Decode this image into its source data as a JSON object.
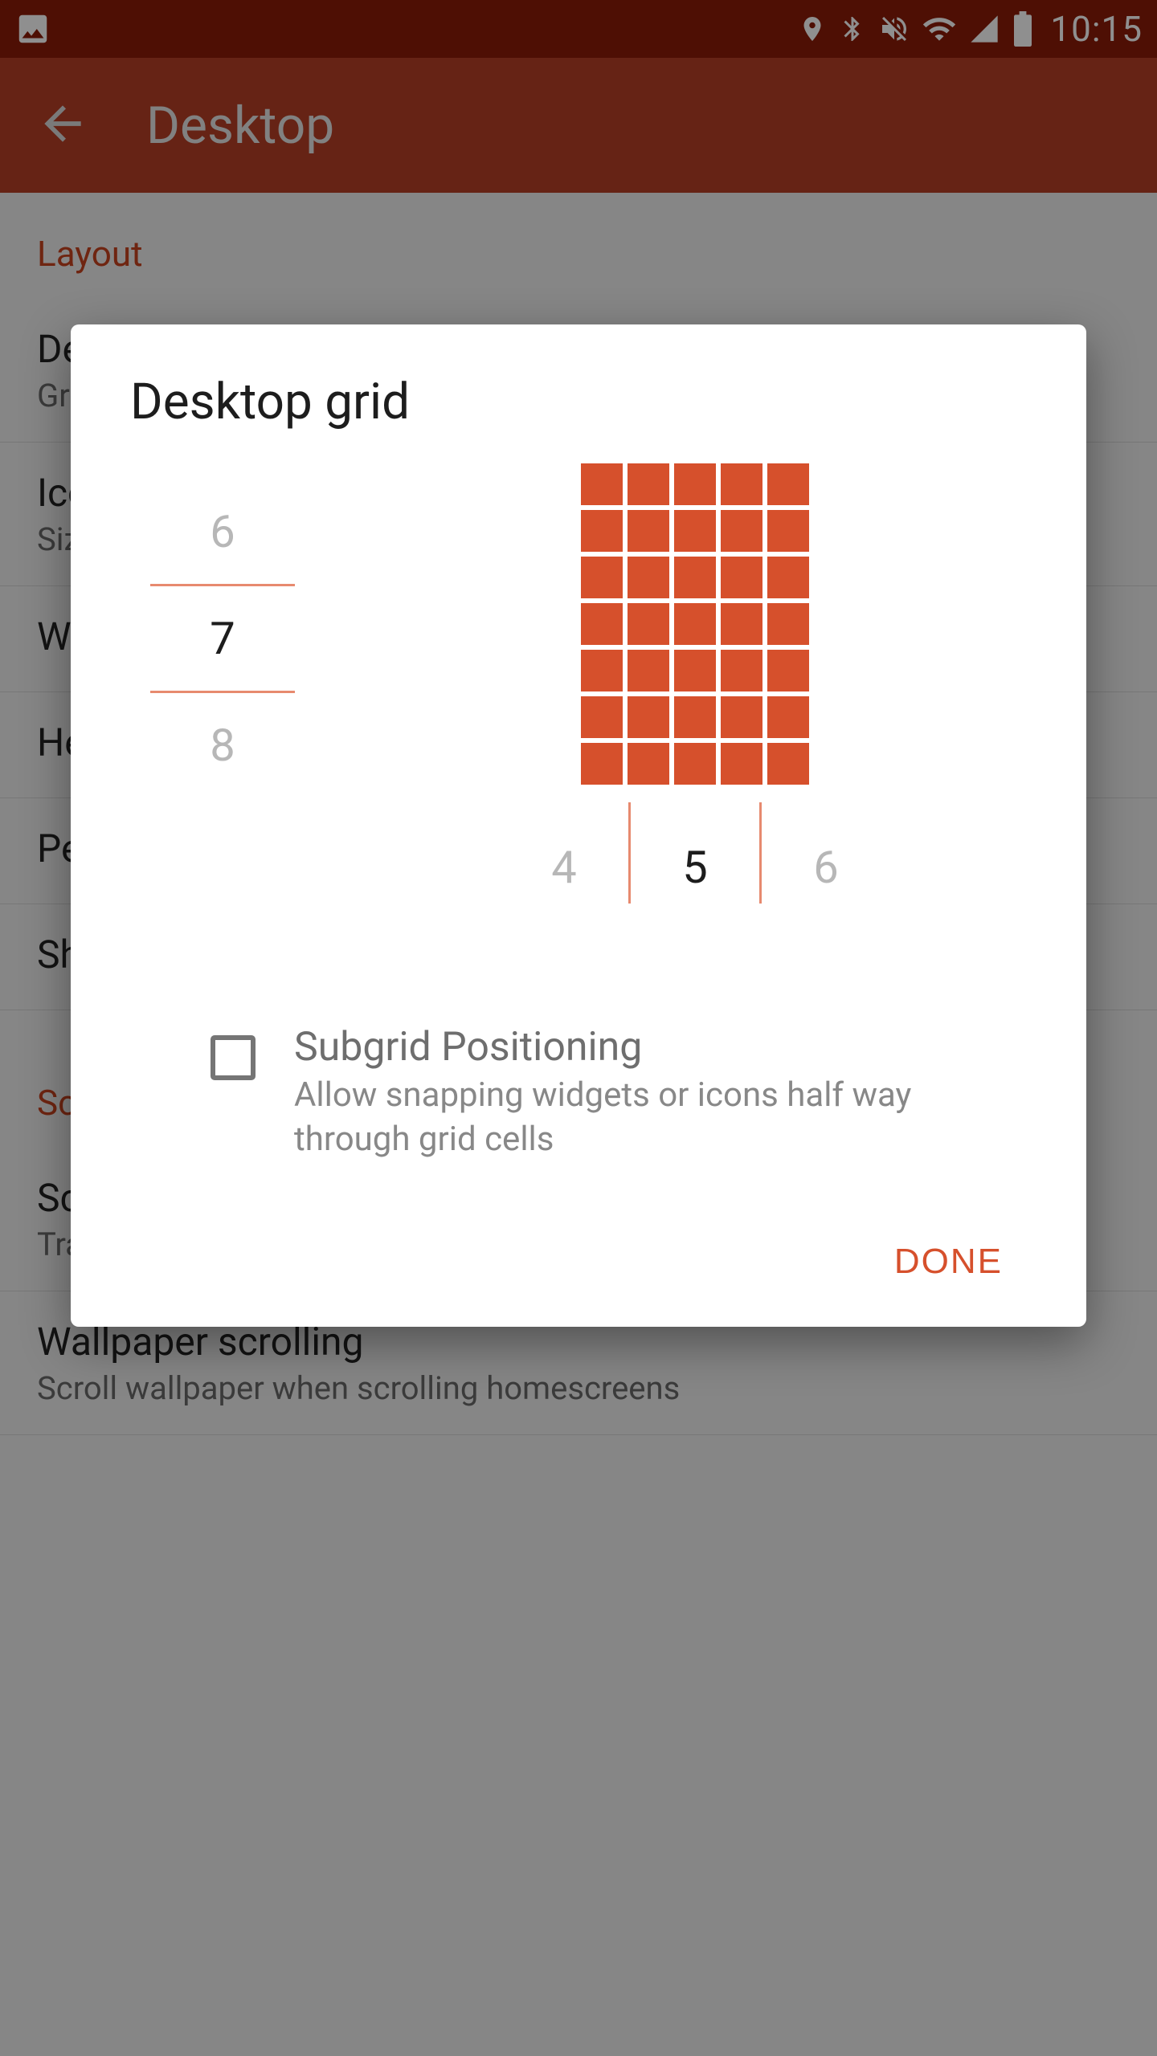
{
  "status": {
    "clock": "10:15"
  },
  "appbar": {
    "title": "Desktop"
  },
  "sections": {
    "layout_header": "Layout",
    "scrolling_header": "Scrolling"
  },
  "prefs": {
    "desktop_grid": {
      "title": "Desktop grid",
      "sub": "Grid size used on the main home screen"
    },
    "icon_size": {
      "title": "Icon layout",
      "sub": "Size and labels of desktop icons"
    },
    "width": {
      "title": "Width padding"
    },
    "height": {
      "title": "Height padding"
    },
    "persistent": {
      "title": "Persistent search bar"
    },
    "shadow": {
      "title": "Shadow effect"
    },
    "scroll_effect": {
      "title": "Scroll effect",
      "sub": "Transition effect when scrolling between home screens"
    },
    "wallpaper": {
      "title": "Wallpaper scrolling",
      "sub": "Scroll wallpaper when scrolling homescreens"
    }
  },
  "dialog": {
    "title": "Desktop grid",
    "rows": {
      "prev": "6",
      "current": "7",
      "next": "8",
      "value": 7
    },
    "cols": {
      "prev": "4",
      "current": "5",
      "next": "6",
      "value": 5
    },
    "subgrid": {
      "title": "Subgrid Positioning",
      "desc": "Allow snapping widgets or icons half way through grid cells",
      "checked": false
    },
    "done": "DONE"
  }
}
